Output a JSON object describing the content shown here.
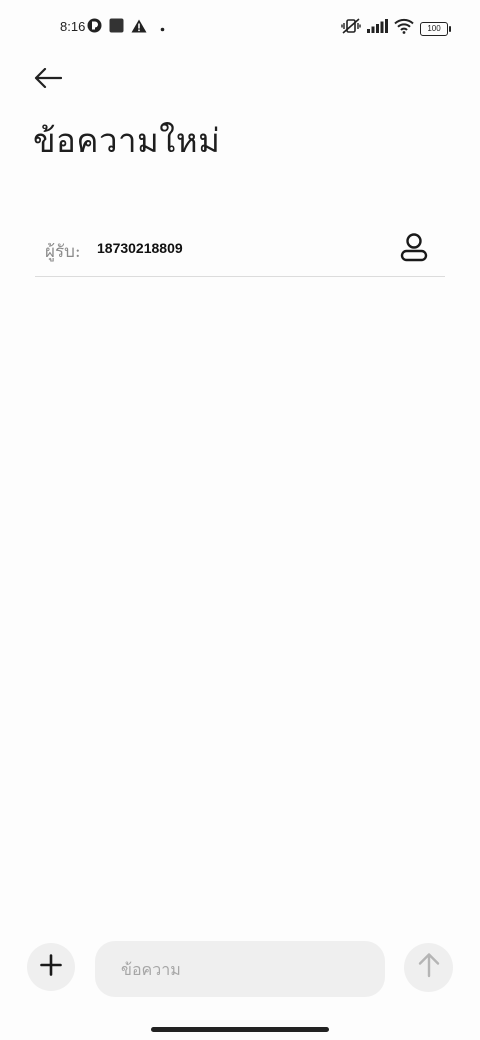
{
  "status_bar": {
    "time": "8:16",
    "battery_level": "100",
    "left_icons": [
      "app-notification-icon",
      "square-notification-icon",
      "warning-icon",
      "dot-icon"
    ],
    "right_icons": [
      "vibrate-off-icon",
      "signal-icon",
      "wifi-icon",
      "battery-icon"
    ]
  },
  "header": {
    "back_icon": "back-arrow-icon",
    "title": "ข้อความใหม่"
  },
  "recipient": {
    "label": "ผู้รับ:",
    "value": "18730218809",
    "contact_icon": "person-icon"
  },
  "composer": {
    "attach_icon": "plus-icon",
    "placeholder": "ข้อความ",
    "value": "",
    "send_icon": "arrow-up-icon"
  },
  "colors": {
    "background": "#fdfdfd",
    "button_bg": "#efefef",
    "divider": "#dcdcdc",
    "placeholder": "#a6a6a6",
    "send_icon_disabled": "#b5b5b5"
  }
}
